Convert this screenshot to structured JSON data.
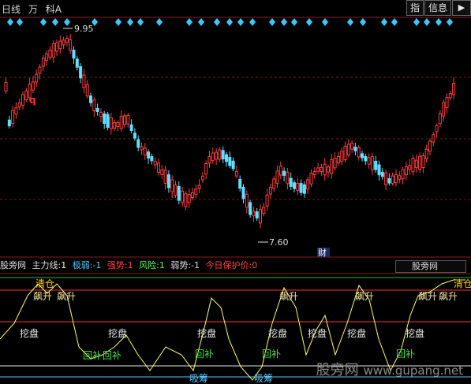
{
  "toolbar": {
    "period": "日线",
    "unit": "万",
    "subject": "科A",
    "btn_index": "指",
    "btn_info": "信息",
    "btn_close": "▶"
  },
  "price": {
    "high_label": "9.95",
    "low_label": "7.60",
    "event_marker": "q",
    "finance_marker": "财"
  },
  "indicator": {
    "source": "股旁网",
    "main_label": "主力线:",
    "main_value": "1",
    "extreme_label": "极弱:",
    "extreme_value": "-1",
    "strong_label": "强势:",
    "strong_value": "1",
    "risk_label": "风险:",
    "risk_value": "1",
    "weak_label": "弱势:",
    "weak_value": "-1",
    "protect_label": "今日保护价:",
    "protect_value": "0",
    "tab": "股旁网"
  },
  "signals": {
    "clear": "清仓",
    "rise": "飙升",
    "dig": "挖盘",
    "fill": "回补",
    "absorb": "吸筹"
  },
  "watermark": {
    "cn": "股旁网",
    "url": "www.gupang.net"
  },
  "colors": {
    "up": "#ff3c3c",
    "down": "#5fe0ff",
    "line": "#ffff66",
    "diamond": "#3cc8ff"
  }
}
